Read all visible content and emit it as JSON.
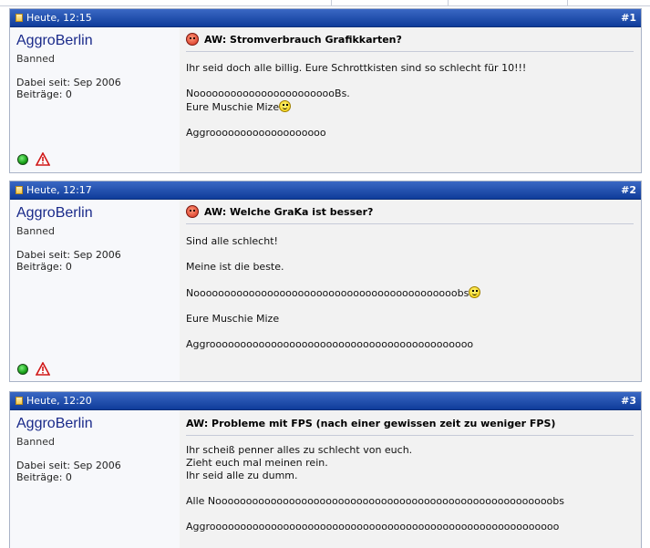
{
  "posts": [
    {
      "date": "Heute, 12:15",
      "number": "#1",
      "username": "AggroBerlin",
      "user_title": "Banned",
      "join_date": "Dabei seit: Sep 2006",
      "post_count": "Beiträge: 0",
      "title": "AW: Stromverbrauch Grafikkarten?",
      "title_icon": "angry-icon",
      "lines": {
        "l1": "Ihr seid doch alle billig. Eure Schrottkisten sind so schlecht für 10!!!",
        "l2": "NoooooooooooooooooooooooBs.",
        "l3": "Eure Muschie Mize",
        "l4": "Aggrooooooooooooooooooo"
      }
    },
    {
      "date": "Heute, 12:17",
      "number": "#2",
      "username": "AggroBerlin",
      "user_title": "Banned",
      "join_date": "Dabei seit: Sep 2006",
      "post_count": "Beiträge: 0",
      "title": "AW: Welche GraKa ist besser?",
      "title_icon": "angry-icon",
      "lines": {
        "l1": "Sind alle schlecht!",
        "l2": "Meine ist die beste.",
        "l3": "Nooooooooooooooooooooooooooooooooooooooooooobs",
        "l4": "Eure Muschie Mize",
        "l5": "Aggrooooooooooooooooooooooooooooooooooooooooooo"
      }
    },
    {
      "date": "Heute, 12:20",
      "number": "#3",
      "username": "AggroBerlin",
      "user_title": "Banned",
      "join_date": "Dabei seit: Sep 2006",
      "post_count": "Beiträge: 0",
      "title": "AW: Probleme mit FPS (nach einer gewissen zeit zu weniger FPS)",
      "lines": {
        "l1": "Ihr scheiß penner alles zu schlecht von euch.",
        "l2": "Zieht euch mal meinen rein.",
        "l3": "Ihr seid alle zu dumm.",
        "l4": "Alle Nooooooooooooooooooooooooooooooooooooooooooooooooooooooobs",
        "l5": "Aggrooooooooooooooooooooooooooooooooooooooooooooooooooooooooo"
      }
    }
  ],
  "icons": {
    "post_icon": "document-icon",
    "online_status": "online-status-icon",
    "report": "report-post-icon",
    "smiley": "smiley-icon"
  },
  "colors": {
    "header_blue": "#1a4aa8",
    "username": "#1a2a8a",
    "content_bg": "#f2f2f2"
  }
}
